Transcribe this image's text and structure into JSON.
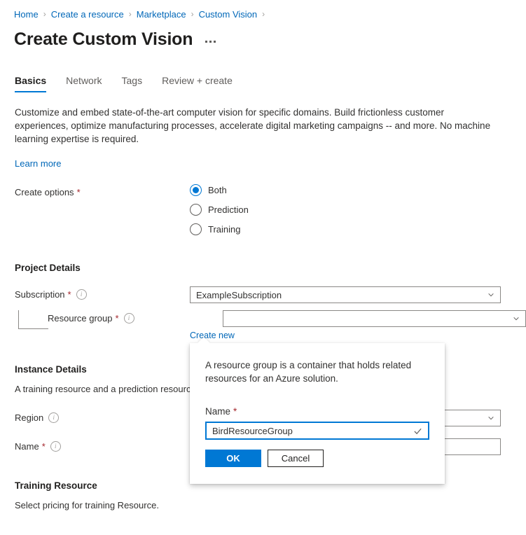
{
  "breadcrumb": {
    "separator": "›",
    "items": [
      {
        "label": "Home"
      },
      {
        "label": "Create a resource"
      },
      {
        "label": "Marketplace"
      },
      {
        "label": "Custom Vision"
      }
    ]
  },
  "header": {
    "title": "Create Custom Vision",
    "more_menu": "..."
  },
  "tabs": [
    {
      "label": "Basics",
      "active": true
    },
    {
      "label": "Network",
      "active": false
    },
    {
      "label": "Tags",
      "active": false
    },
    {
      "label": "Review + create",
      "active": false
    }
  ],
  "intro": {
    "description": "Customize and embed state-of-the-art computer vision for specific domains. Build frictionless customer experiences, optimize manufacturing processes, accelerate digital marketing campaigns -- and more. No machine learning expertise is required.",
    "learn_more": "Learn more"
  },
  "create_options": {
    "label": "Create options",
    "required_mark": "*",
    "options": [
      {
        "label": "Both",
        "checked": true
      },
      {
        "label": "Prediction",
        "checked": false
      },
      {
        "label": "Training",
        "checked": false
      }
    ]
  },
  "project_details": {
    "heading": "Project Details",
    "subscription": {
      "label": "Subscription",
      "required_mark": "*",
      "value": "ExampleSubscription"
    },
    "resource_group": {
      "label": "Resource group",
      "required_mark": "*",
      "value": "",
      "create_new_link": "Create new"
    }
  },
  "instance_details": {
    "heading": "Instance Details",
    "description": "A training resource and a prediction resourc",
    "region": {
      "label": "Region",
      "value": ""
    },
    "name": {
      "label": "Name",
      "required_mark": "*",
      "value": ""
    }
  },
  "training_resource": {
    "heading": "Training Resource",
    "description": "Select pricing for training Resource."
  },
  "callout": {
    "description": "A resource group is a container that holds related resources for an Azure solution.",
    "name_label": "Name",
    "required_mark": "*",
    "name_value": "BirdResourceGroup",
    "name_placeholder": "",
    "ok_label": "OK",
    "cancel_label": "Cancel"
  },
  "colors": {
    "accent": "#0078d4",
    "link": "#0067b8",
    "required": "#a4262c",
    "border": "#8a8886",
    "text": "#323130"
  }
}
